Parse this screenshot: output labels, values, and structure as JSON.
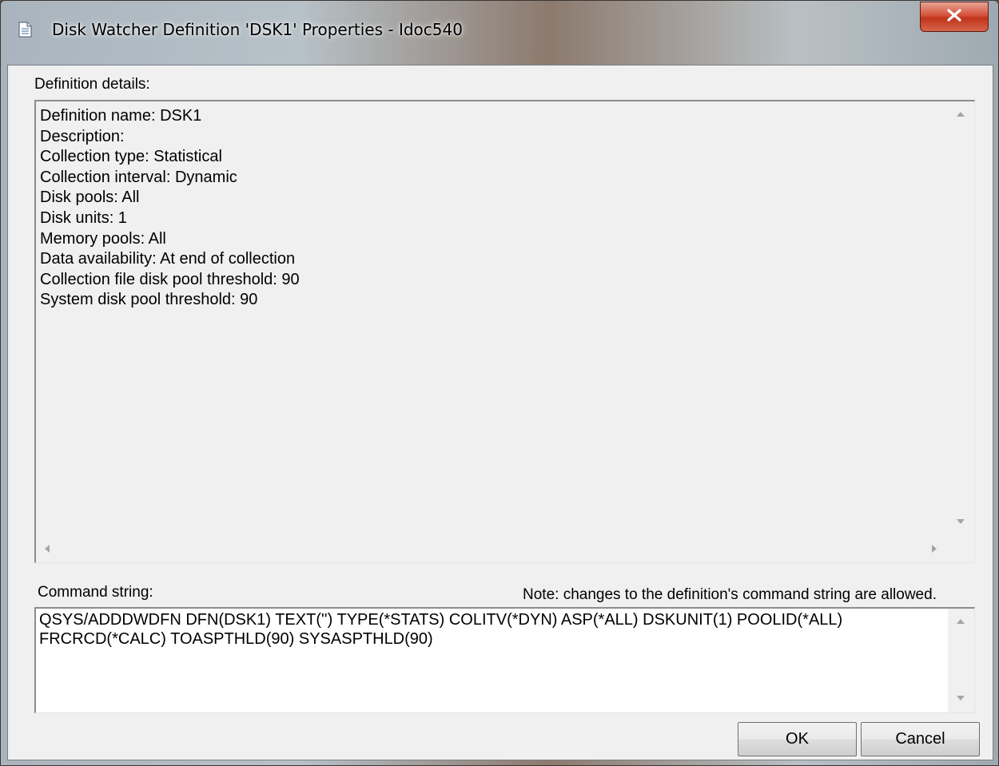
{
  "window": {
    "title": "Disk Watcher Definition 'DSK1' Properties - Idoc540"
  },
  "details": {
    "label": "Definition details:",
    "lines": [
      "Definition name:  DSK1",
      "Description:",
      "Collection type:  Statistical",
      "Collection interval:  Dynamic",
      "Disk pools:  All",
      "Disk units:  1",
      "Memory pools:  All",
      "Data availability:  At end of collection",
      "Collection file disk pool threshold:  90",
      "System disk pool threshold:  90"
    ]
  },
  "command": {
    "label": "Command string:",
    "note": "Note: changes to the definition's command string are allowed.",
    "value": "QSYS/ADDDWDFN DFN(DSK1) TEXT('') TYPE(*STATS) COLITV(*DYN) ASP(*ALL) DSKUNIT(1) POOLID(*ALL) FRCRCD(*CALC) TOASPTHLD(90) SYSASPTHLD(90)"
  },
  "buttons": {
    "ok_label": "OK",
    "cancel_label": "Cancel"
  },
  "icons": {
    "window_icon": "document-icon",
    "close": "close-icon"
  },
  "colors": {
    "close_button": "#c0341b",
    "client_background": "#f0f0f0"
  }
}
